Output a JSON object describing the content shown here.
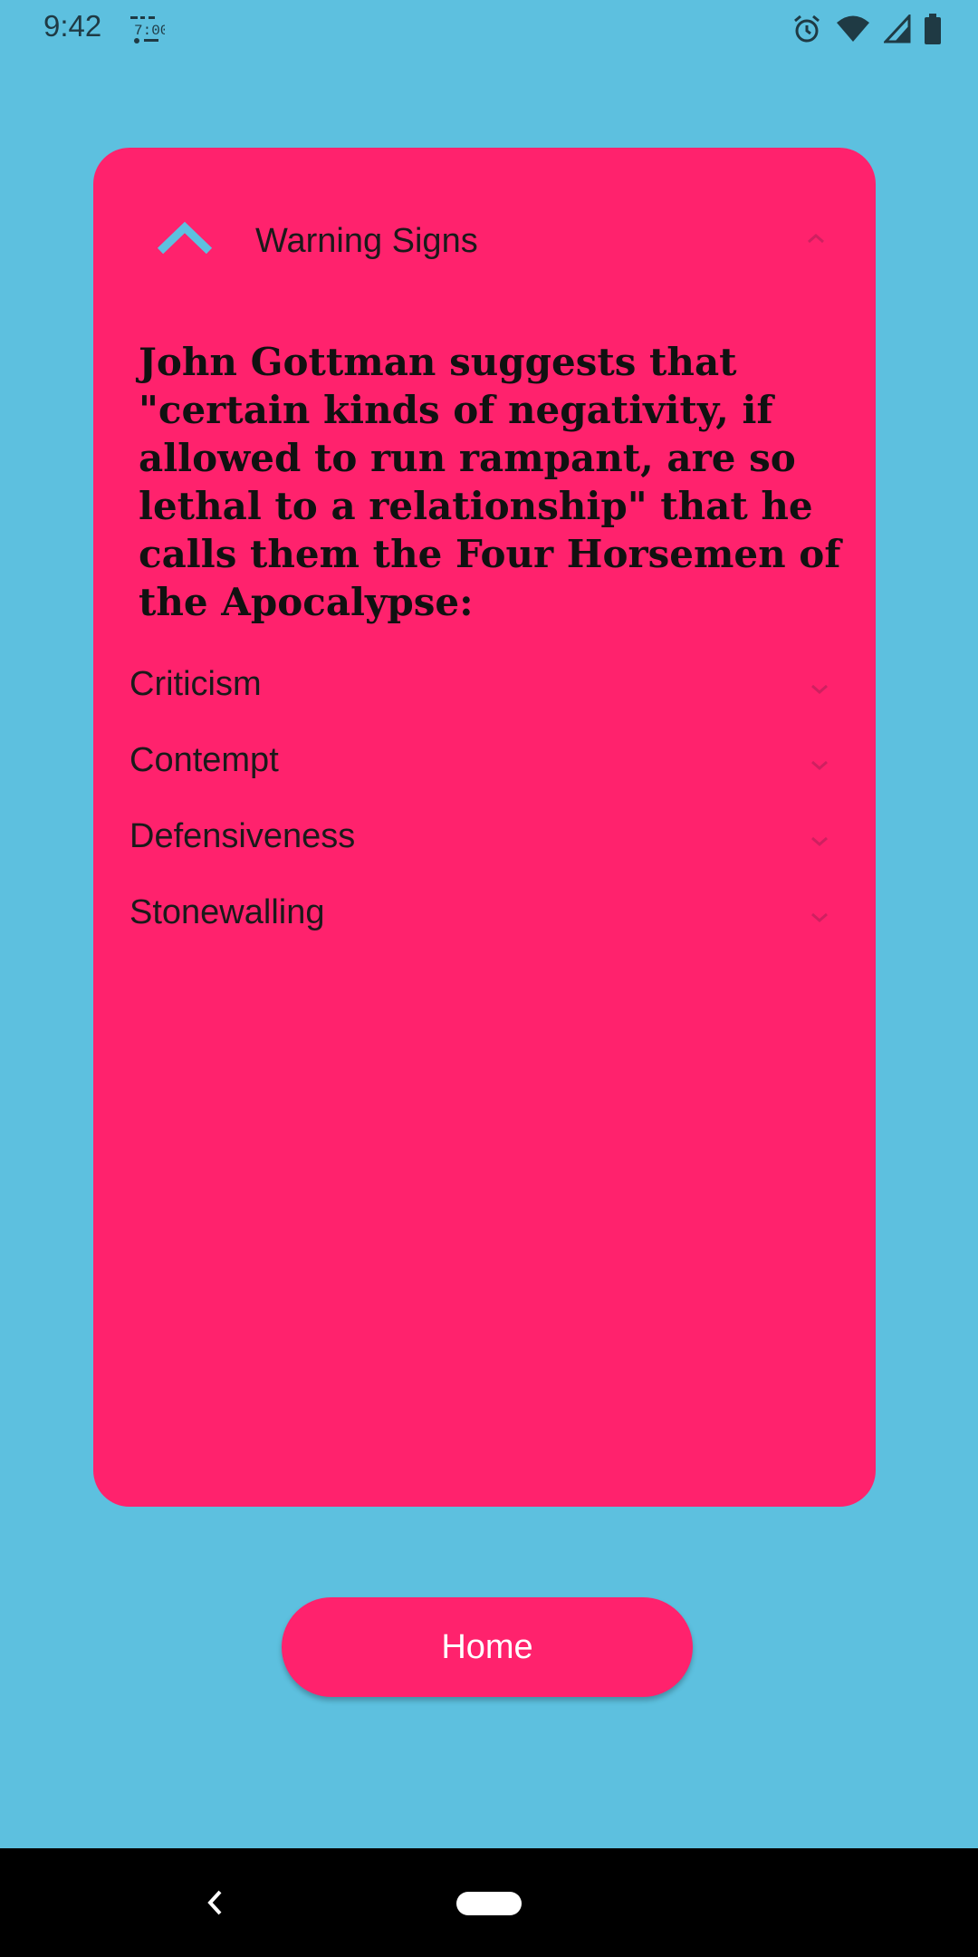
{
  "status_bar": {
    "time": "9:42",
    "notification_icon": "clock-app-icon",
    "icons": [
      "alarm-icon",
      "wifi-icon",
      "signal-icon",
      "battery-icon"
    ]
  },
  "card": {
    "title": "Warning Signs",
    "header_icon": "chevron-up-icon",
    "intro": "John Gottman suggests that \"certain kinds of negativity, if allowed to run rampant, are so lethal to a relationship\" that he calls them the Four Horsemen of the Apocalypse:",
    "items": [
      {
        "label": "Criticism"
      },
      {
        "label": "Contempt"
      },
      {
        "label": "Defensiveness"
      },
      {
        "label": "Stonewalling"
      }
    ]
  },
  "home_button": {
    "label": "Home"
  },
  "nav_bar": {
    "icons": [
      "back-icon",
      "home-pill-icon"
    ]
  },
  "colors": {
    "background": "#5DC0DF",
    "accent": "#FF226D",
    "header_icon": "#5DC0DF",
    "text": "#1a1a1a",
    "button_text": "#ffffff"
  }
}
